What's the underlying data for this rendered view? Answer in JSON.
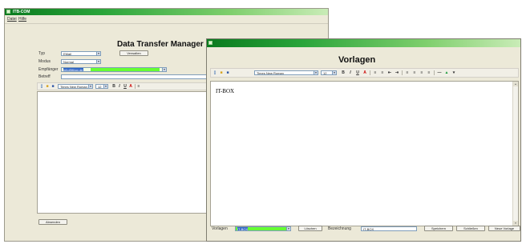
{
  "main_window": {
    "title": "ITB-COM",
    "menu": [
      "Datei",
      "Hilfe"
    ],
    "heading": "Data Transfer Manager",
    "fields": {
      "typ": {
        "label": "Typ",
        "value": "EMail"
      },
      "modus": {
        "label": "Modus",
        "value": "Normal"
      },
      "empfaenger": {
        "label": "Empfänger",
        "value": "info@itbox.de"
      },
      "betreff": {
        "label": "Betreff",
        "value": ""
      }
    },
    "verwalten_button": "Verwalten",
    "font_name": "Times New Roman",
    "font_size": "12",
    "absenden_button": "Absenden"
  },
  "vorlagen_window": {
    "title": "",
    "heading": "Vorlagen",
    "font_name": "Times New Roman",
    "font_size": "12",
    "editor_text": "IT-BOX",
    "footer": {
      "vorlagen_label": "Vorlagen",
      "vorlagen_value": "IT-BOX",
      "loeschen_button": "Löschen",
      "bezeichnung_label": "Bezeichnung",
      "bezeichnung_value": "IT-BOX",
      "speichern_button": "Speichern",
      "schliessen_button": "Schließen",
      "neue_vorlage_button": "Neue Vorlage"
    }
  },
  "colors": {
    "titlebar_start": "#0a7a1e",
    "titlebar_end": "#c9ecb7",
    "highlight_green": "#66ff33",
    "selection_blue": "#3166c5"
  }
}
